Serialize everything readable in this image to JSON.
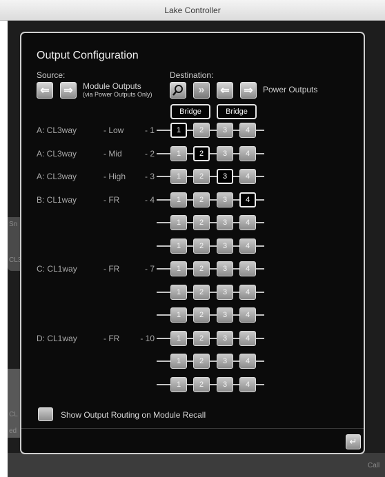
{
  "window": {
    "title": "Lake Controller"
  },
  "background": {
    "frag_left_top": "Sn",
    "frag_left_mid": "CL3",
    "frag_left_bottom": "CL",
    "frag_left_bottom2": "ed",
    "frag_right_bottom": "Call"
  },
  "dialog": {
    "title": "Output Configuration",
    "source": {
      "label": "Source:",
      "prev_icon": "left-arrow-icon",
      "next_icon": "right-arrow-icon",
      "name": "Module Outputs",
      "subtitle": "(via Power Outputs Only)"
    },
    "destination": {
      "label": "Destination:",
      "search_icon": "magnifier-icon",
      "name": "Power Outputs"
    },
    "bridge_buttons": [
      "Bridge",
      "Bridge"
    ],
    "cell_labels": [
      "1",
      "2",
      "3",
      "4"
    ],
    "rows": [
      {
        "name": "A: CL3way",
        "band": "- Low",
        "num": "- 1",
        "active": 1
      },
      {
        "name": "A: CL3way",
        "band": "- Mid",
        "num": "- 2",
        "active": 2
      },
      {
        "name": "A: CL3way",
        "band": "- High",
        "num": "- 3",
        "active": 3
      },
      {
        "name": "B: CL1way",
        "band": "- FR",
        "num": "- 4",
        "active": 4
      },
      {
        "name": "",
        "band": "",
        "num": "",
        "active": 0
      },
      {
        "name": "",
        "band": "",
        "num": "",
        "active": 0
      },
      {
        "name": "C: CL1way",
        "band": "- FR",
        "num": "- 7",
        "active": 0
      },
      {
        "name": "",
        "band": "",
        "num": "",
        "active": 0
      },
      {
        "name": "",
        "band": "",
        "num": "",
        "active": 0
      },
      {
        "name": "D: CL1way",
        "band": "- FR",
        "num": "- 10",
        "active": 0
      },
      {
        "name": "",
        "band": "",
        "num": "",
        "active": 0
      },
      {
        "name": "",
        "band": "",
        "num": "",
        "active": 0
      }
    ],
    "show_routing": {
      "label": "Show Output Routing on Module Recall",
      "checked": false
    },
    "enter_icon": "enter-return-icon"
  }
}
